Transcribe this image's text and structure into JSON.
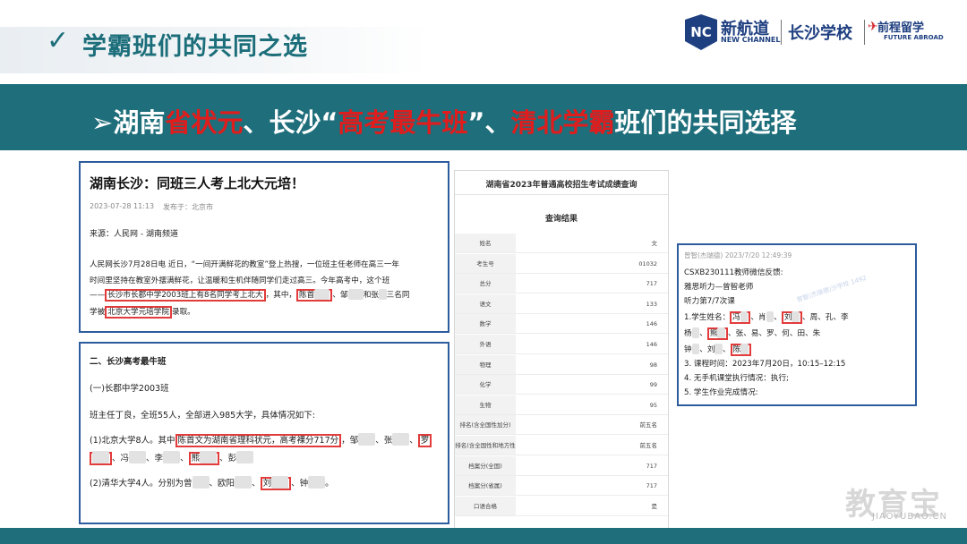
{
  "header": {
    "check": "✓",
    "title": "学霸班们的共同之选",
    "logo": {
      "nc": "NC",
      "brand_cn": "新航道",
      "brand_en": "NEW CHANNEL",
      "school": "长沙学校",
      "partner_cn": "前程留学",
      "partner_en": "FUTURE ABROAD"
    }
  },
  "banner": {
    "arrow": "➢",
    "seg1": "湖南",
    "seg2": "省状元",
    "seg3": "、长沙“",
    "seg4": "高考最牛班",
    "seg5": "”、",
    "seg6": "清北学霸",
    "seg7": "班们的共同选择"
  },
  "article1": {
    "title": "湖南长沙：同班三人考上北大元培！",
    "date": "2023-07-28 11:13",
    "place": "发布于：北京市",
    "source": "来源：人民网 - 湖南频道",
    "l1": "人民网长沙7月28日电 近日，“一间开满鲜花的教室”登上热搜，一位班主任老师在高三一年",
    "l2": "时间里坚持在教室外摆满鲜花，让温暖和生机伴随同学们走过高三。今年高考中，这个班",
    "l3a": "——",
    "l3b": "长沙市长郡中学2003班上有8名同学考上北大",
    "l3c": "，其中，",
    "l3d": "陈首",
    "l3e": "、邹",
    "l3f": "和张",
    "l3g": "三名同",
    "l4a": "学被",
    "l4b": "北京大学元培学院",
    "l4c": "录取。"
  },
  "article2": {
    "heading": "二、长沙高考最牛班",
    "sub": "(一)长郡中学2003班",
    "p1": "班主任丁良，全班55人，全部进入985大学，具体情况如下:",
    "l1a": "(1)北京大学8人。其中",
    "l1b": "陈首文为湖南省理科状元，高考裸分717分",
    "l1c": "，邹",
    "l1d": "、张",
    "l1e": "、",
    "l1f": "罗",
    "l2a": "、冯",
    "l2b": "、李",
    "l2c": "、",
    "l2d": "熊",
    "l2e": "、彭",
    "l3a": "(2)清华大学4人。分别为曾",
    "l3b": "、欧阳",
    "l3c": "、",
    "l3d": "刘",
    "l3e": "、钟",
    "l3f": "。"
  },
  "score": {
    "title": "湖南省2023年普通高校招生考试成绩查询",
    "subtitle": "查询结果",
    "rows": [
      {
        "k": "姓名",
        "v": "文"
      },
      {
        "k": "考生号",
        "v": "01032"
      },
      {
        "k": "总分",
        "v": "717"
      },
      {
        "k": "语文",
        "v": "133"
      },
      {
        "k": "数学",
        "v": "146"
      },
      {
        "k": "外语",
        "v": "146"
      },
      {
        "k": "物理",
        "v": "98"
      },
      {
        "k": "化学",
        "v": "99"
      },
      {
        "k": "生物",
        "v": "95"
      },
      {
        "k": "排名(含全国性加分)",
        "v": "前五名"
      },
      {
        "k": "排名(含全国性和地方性加分)",
        "v": "前五名"
      },
      {
        "k": "档案分(全国)",
        "v": "717"
      },
      {
        "k": "档案分(省属)",
        "v": "717"
      },
      {
        "k": "口语合格",
        "v": "是"
      }
    ]
  },
  "feedback": {
    "sender": "曾智(杰瑞德) 2023/7/20 12:49:39",
    "l1": "CSXB230111教师微信反馈:",
    "l2": "雅思听力—曾智老师",
    "l3": "听力第7/7次课",
    "l4a": "1.学生姓名：",
    "l4b": "冯",
    "l4c": "、肖",
    "l4d": "、",
    "l4e": "刘",
    "l4f": "、周",
    "l4g": "、孔",
    "l4h": "、李",
    "l5a": "杨",
    "l5b": "、",
    "l5c": "熊",
    "l5d": "、张",
    "l5e": "、易",
    "l5f": "、罗",
    "l5g": "、何",
    "l5h": "、田",
    "l5i": "、朱",
    "l6a": "钟",
    "l6b": "、刘",
    "l6c": "、",
    "l6d": "陈",
    "l7": "3. 课程时间：2023年7月20日，10:15–12:15",
    "l8": "4. 无手机课堂执行情况：执行;",
    "l9": "5. 学生作业完成情况:",
    "watermark": "曾智(杰瑞德)沙学校 1492"
  },
  "footer": {
    "brand_cn": "教育宝",
    "brand_url": "JIAOYUBAO.CN"
  }
}
